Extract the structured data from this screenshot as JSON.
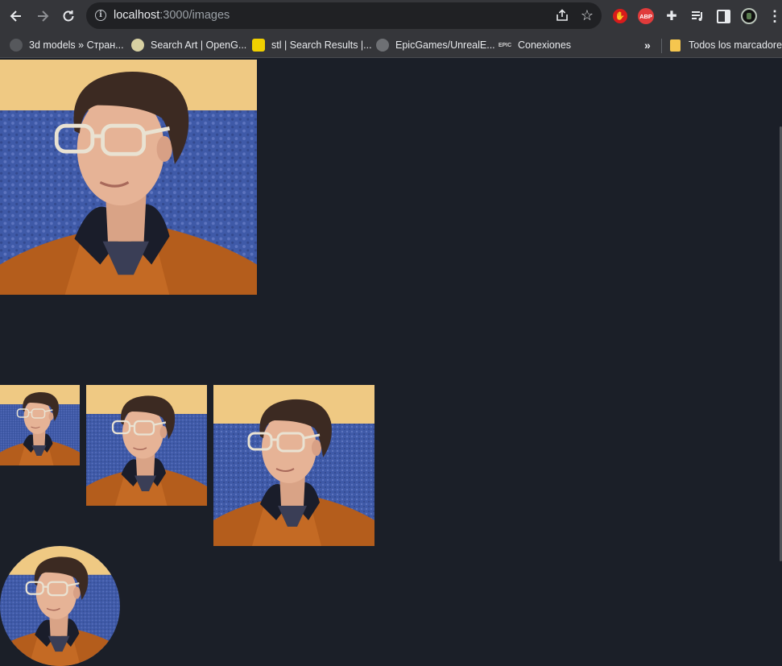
{
  "browser": {
    "url_host": "localhost",
    "url_path": ":3000/images",
    "bookmarks": [
      {
        "label": "3d models » Стран..."
      },
      {
        "label": "Search Art | OpenG..."
      },
      {
        "label": "stl | Search Results |..."
      },
      {
        "label": "EpicGames/UnrealE..."
      },
      {
        "label": "Conexiones"
      }
    ],
    "bookmarks_more": "»",
    "all_bookmarks": "Todos los marcadores",
    "abp_label": "ABP",
    "epic_label": "EPIC"
  },
  "page": {
    "background": "#1b1f28",
    "images": [
      {
        "name": "hero-photo",
        "shape": "square"
      },
      {
        "name": "small-photo",
        "shape": "square"
      },
      {
        "name": "medium-photo",
        "shape": "square"
      },
      {
        "name": "large-photo",
        "shape": "square"
      },
      {
        "name": "round-photo",
        "shape": "circle"
      }
    ]
  }
}
